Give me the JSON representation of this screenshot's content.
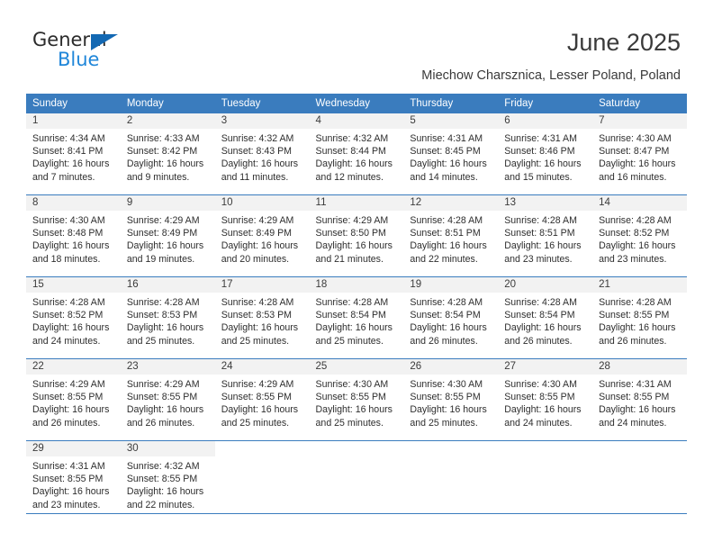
{
  "brand": {
    "name_part1": "General",
    "name_part2": "Blue",
    "color_dark": "#2b2b2b",
    "color_blue": "#1f86d9",
    "triangle_color": "#1268b3"
  },
  "header": {
    "title": "June 2025",
    "subtitle": "Miechow Charsznica, Lesser Poland, Poland",
    "accent_color": "#3a7cbe"
  },
  "calendar": {
    "weekday_headers": [
      "Sunday",
      "Monday",
      "Tuesday",
      "Wednesday",
      "Thursday",
      "Friday",
      "Saturday"
    ],
    "weeks": [
      [
        {
          "day": "1",
          "sunrise": "Sunrise: 4:34 AM",
          "sunset": "Sunset: 8:41 PM",
          "daylight": "Daylight: 16 hours and 7 minutes."
        },
        {
          "day": "2",
          "sunrise": "Sunrise: 4:33 AM",
          "sunset": "Sunset: 8:42 PM",
          "daylight": "Daylight: 16 hours and 9 minutes."
        },
        {
          "day": "3",
          "sunrise": "Sunrise: 4:32 AM",
          "sunset": "Sunset: 8:43 PM",
          "daylight": "Daylight: 16 hours and 11 minutes."
        },
        {
          "day": "4",
          "sunrise": "Sunrise: 4:32 AM",
          "sunset": "Sunset: 8:44 PM",
          "daylight": "Daylight: 16 hours and 12 minutes."
        },
        {
          "day": "5",
          "sunrise": "Sunrise: 4:31 AM",
          "sunset": "Sunset: 8:45 PM",
          "daylight": "Daylight: 16 hours and 14 minutes."
        },
        {
          "day": "6",
          "sunrise": "Sunrise: 4:31 AM",
          "sunset": "Sunset: 8:46 PM",
          "daylight": "Daylight: 16 hours and 15 minutes."
        },
        {
          "day": "7",
          "sunrise": "Sunrise: 4:30 AM",
          "sunset": "Sunset: 8:47 PM",
          "daylight": "Daylight: 16 hours and 16 minutes."
        }
      ],
      [
        {
          "day": "8",
          "sunrise": "Sunrise: 4:30 AM",
          "sunset": "Sunset: 8:48 PM",
          "daylight": "Daylight: 16 hours and 18 minutes."
        },
        {
          "day": "9",
          "sunrise": "Sunrise: 4:29 AM",
          "sunset": "Sunset: 8:49 PM",
          "daylight": "Daylight: 16 hours and 19 minutes."
        },
        {
          "day": "10",
          "sunrise": "Sunrise: 4:29 AM",
          "sunset": "Sunset: 8:49 PM",
          "daylight": "Daylight: 16 hours and 20 minutes."
        },
        {
          "day": "11",
          "sunrise": "Sunrise: 4:29 AM",
          "sunset": "Sunset: 8:50 PM",
          "daylight": "Daylight: 16 hours and 21 minutes."
        },
        {
          "day": "12",
          "sunrise": "Sunrise: 4:28 AM",
          "sunset": "Sunset: 8:51 PM",
          "daylight": "Daylight: 16 hours and 22 minutes."
        },
        {
          "day": "13",
          "sunrise": "Sunrise: 4:28 AM",
          "sunset": "Sunset: 8:51 PM",
          "daylight": "Daylight: 16 hours and 23 minutes."
        },
        {
          "day": "14",
          "sunrise": "Sunrise: 4:28 AM",
          "sunset": "Sunset: 8:52 PM",
          "daylight": "Daylight: 16 hours and 23 minutes."
        }
      ],
      [
        {
          "day": "15",
          "sunrise": "Sunrise: 4:28 AM",
          "sunset": "Sunset: 8:52 PM",
          "daylight": "Daylight: 16 hours and 24 minutes."
        },
        {
          "day": "16",
          "sunrise": "Sunrise: 4:28 AM",
          "sunset": "Sunset: 8:53 PM",
          "daylight": "Daylight: 16 hours and 25 minutes."
        },
        {
          "day": "17",
          "sunrise": "Sunrise: 4:28 AM",
          "sunset": "Sunset: 8:53 PM",
          "daylight": "Daylight: 16 hours and 25 minutes."
        },
        {
          "day": "18",
          "sunrise": "Sunrise: 4:28 AM",
          "sunset": "Sunset: 8:54 PM",
          "daylight": "Daylight: 16 hours and 25 minutes."
        },
        {
          "day": "19",
          "sunrise": "Sunrise: 4:28 AM",
          "sunset": "Sunset: 8:54 PM",
          "daylight": "Daylight: 16 hours and 26 minutes."
        },
        {
          "day": "20",
          "sunrise": "Sunrise: 4:28 AM",
          "sunset": "Sunset: 8:54 PM",
          "daylight": "Daylight: 16 hours and 26 minutes."
        },
        {
          "day": "21",
          "sunrise": "Sunrise: 4:28 AM",
          "sunset": "Sunset: 8:55 PM",
          "daylight": "Daylight: 16 hours and 26 minutes."
        }
      ],
      [
        {
          "day": "22",
          "sunrise": "Sunrise: 4:29 AM",
          "sunset": "Sunset: 8:55 PM",
          "daylight": "Daylight: 16 hours and 26 minutes."
        },
        {
          "day": "23",
          "sunrise": "Sunrise: 4:29 AM",
          "sunset": "Sunset: 8:55 PM",
          "daylight": "Daylight: 16 hours and 26 minutes."
        },
        {
          "day": "24",
          "sunrise": "Sunrise: 4:29 AM",
          "sunset": "Sunset: 8:55 PM",
          "daylight": "Daylight: 16 hours and 25 minutes."
        },
        {
          "day": "25",
          "sunrise": "Sunrise: 4:30 AM",
          "sunset": "Sunset: 8:55 PM",
          "daylight": "Daylight: 16 hours and 25 minutes."
        },
        {
          "day": "26",
          "sunrise": "Sunrise: 4:30 AM",
          "sunset": "Sunset: 8:55 PM",
          "daylight": "Daylight: 16 hours and 25 minutes."
        },
        {
          "day": "27",
          "sunrise": "Sunrise: 4:30 AM",
          "sunset": "Sunset: 8:55 PM",
          "daylight": "Daylight: 16 hours and 24 minutes."
        },
        {
          "day": "28",
          "sunrise": "Sunrise: 4:31 AM",
          "sunset": "Sunset: 8:55 PM",
          "daylight": "Daylight: 16 hours and 24 minutes."
        }
      ],
      [
        {
          "day": "29",
          "sunrise": "Sunrise: 4:31 AM",
          "sunset": "Sunset: 8:55 PM",
          "daylight": "Daylight: 16 hours and 23 minutes."
        },
        {
          "day": "30",
          "sunrise": "Sunrise: 4:32 AM",
          "sunset": "Sunset: 8:55 PM",
          "daylight": "Daylight: 16 hours and 22 minutes."
        },
        {
          "day": "",
          "sunrise": "",
          "sunset": "",
          "daylight": ""
        },
        {
          "day": "",
          "sunrise": "",
          "sunset": "",
          "daylight": ""
        },
        {
          "day": "",
          "sunrise": "",
          "sunset": "",
          "daylight": ""
        },
        {
          "day": "",
          "sunrise": "",
          "sunset": "",
          "daylight": ""
        },
        {
          "day": "",
          "sunrise": "",
          "sunset": "",
          "daylight": ""
        }
      ]
    ]
  }
}
